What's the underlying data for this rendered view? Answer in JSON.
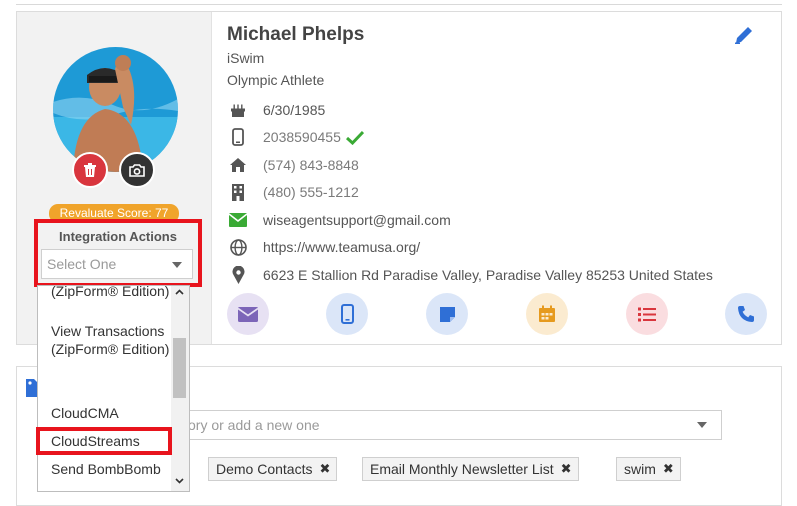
{
  "contact": {
    "name": "Michael Phelps",
    "company": "iSwim",
    "title": "Olympic Athlete",
    "birthday": "6/30/1985",
    "mobile": "2038590455",
    "home_phone": "(574) 843-8848",
    "work_phone": "(480) 555-1212",
    "email": "wiseagentsupport@gmail.com",
    "website": "https://www.teamusa.org/",
    "address": "6623 E Stallion Rd Paradise Valley, Paradise Valley 85253 United States"
  },
  "score_label": "Revaluate Score: 77",
  "integration": {
    "title": "Integration Actions",
    "placeholder": "Select One",
    "options": [
      "(ZipForm® Edition)",
      "View Transactions (ZipForm® Edition)",
      "CloudCMA",
      "CloudStreams",
      "Send BombBomb"
    ],
    "highlighted": "CloudStreams"
  },
  "tags": {
    "placeholder": "ory or add a new one",
    "items": [
      "Demo Contacts",
      "Email Monthly Newsletter List",
      "swim"
    ],
    "remove_glyph": "✖"
  },
  "colors": {
    "accent_blue": "#2f6fd6",
    "highlight_red": "#e8141d",
    "score_orange": "#f0a42b",
    "verified_green": "#3aaa35"
  },
  "icons": {
    "birthday": "birthday-cake-icon",
    "mobile": "mobile-phone-icon",
    "home": "home-icon",
    "work": "building-icon",
    "email": "envelope-icon",
    "website": "globe-icon",
    "address": "map-marker-icon",
    "edit": "pencil-icon"
  }
}
